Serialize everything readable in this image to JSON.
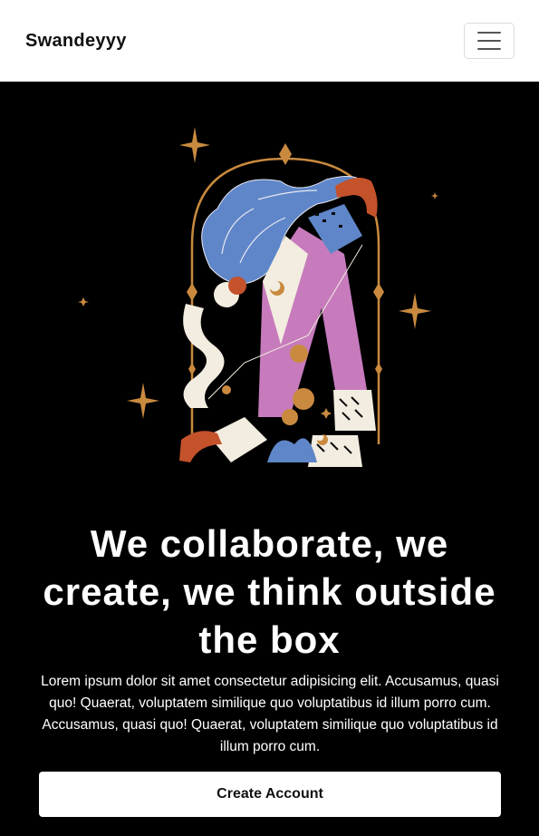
{
  "navbar": {
    "brand": "Swandeyyy",
    "menu_icon": "hamburger-menu-icon"
  },
  "hero": {
    "illustration_icon": "mystical-woman-illustration",
    "headline": "We collaborate, we create, we think outside the box",
    "body": "Lorem ipsum dolor sit amet consectetur adipisicing elit. Accusamus, quasi quo! Quaerat, voluptatem similique quo voluptatibus id illum porro cum. Accusamus, quasi quo! Quaerat, voluptatem similique quo voluptatibus id illum porro cum.",
    "cta_label": "Create Account"
  },
  "colors": {
    "background": "#000000",
    "navbar": "#ffffff",
    "gold": "#c98a3f",
    "blue": "#5f86c8",
    "pink": "#c77bbd",
    "rust": "#c4522b",
    "cream": "#f3ede1"
  }
}
